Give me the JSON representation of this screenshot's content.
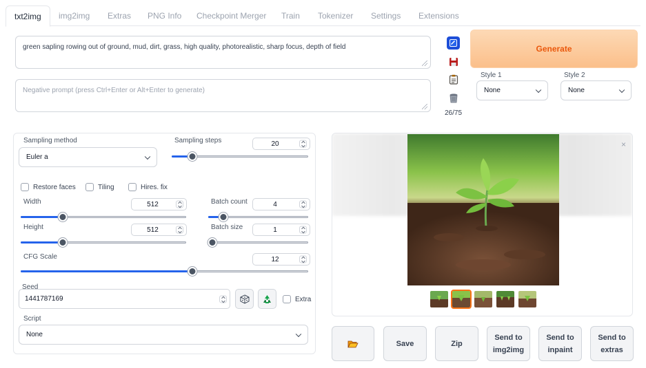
{
  "tabs": [
    {
      "label": "txt2img",
      "active": true
    },
    {
      "label": "img2img"
    },
    {
      "label": "Extras"
    },
    {
      "label": "PNG Info"
    },
    {
      "label": "Checkpoint Merger"
    },
    {
      "label": "Train"
    },
    {
      "label": "Tokenizer"
    },
    {
      "label": "Settings"
    },
    {
      "label": "Extensions"
    }
  ],
  "prompt": {
    "value": "green sapling rowing out of ground, mud, dirt, grass, high quality, photorealistic, sharp focus, depth of field",
    "negative_placeholder": "Negative prompt (press Ctrl+Enter or Alt+Enter to generate)",
    "token_counter": "26/75"
  },
  "tools": [
    "paste-params-icon",
    "save-style-icon",
    "apply-style-icon",
    "clear-icon"
  ],
  "generate_label": "Generate",
  "styles": {
    "style1_label": "Style 1",
    "style1_value": "None",
    "style2_label": "Style 2",
    "style2_value": "None"
  },
  "settings": {
    "sampling_method_label": "Sampling method",
    "sampling_method_value": "Euler a",
    "sampling_steps_label": "Sampling steps",
    "sampling_steps_value": "20",
    "restore_faces_label": "Restore faces",
    "tiling_label": "Tiling",
    "hires_label": "Hires. fix",
    "width_label": "Width",
    "width_value": "512",
    "height_label": "Height",
    "height_value": "512",
    "batch_count_label": "Batch count",
    "batch_count_value": "4",
    "batch_size_label": "Batch size",
    "batch_size_value": "1",
    "cfg_label": "CFG Scale",
    "cfg_value": "12",
    "seed_label": "Seed",
    "seed_value": "1441787169",
    "extra_label": "Extra",
    "script_label": "Script",
    "script_value": "None"
  },
  "slider_levels": {
    "sampling_steps": 0.13,
    "width": 0.24,
    "height": 0.24,
    "batch_count": 0.12,
    "batch_size": 0.0,
    "cfg": 0.6
  },
  "colors": {
    "accent": "#2563eb",
    "generate_bg": "#fbbf8a",
    "generate_text": "#ea580c"
  },
  "actions": {
    "folder_icon": "folder-icon",
    "save": "Save",
    "zip": "Zip",
    "send_img2img": "Send to img2img",
    "send_inpaint": "Send to inpaint",
    "send_extras": "Send to extras"
  },
  "gallery": {
    "close_icon": "×",
    "thumb_count": 5,
    "selected_thumb": 1
  }
}
